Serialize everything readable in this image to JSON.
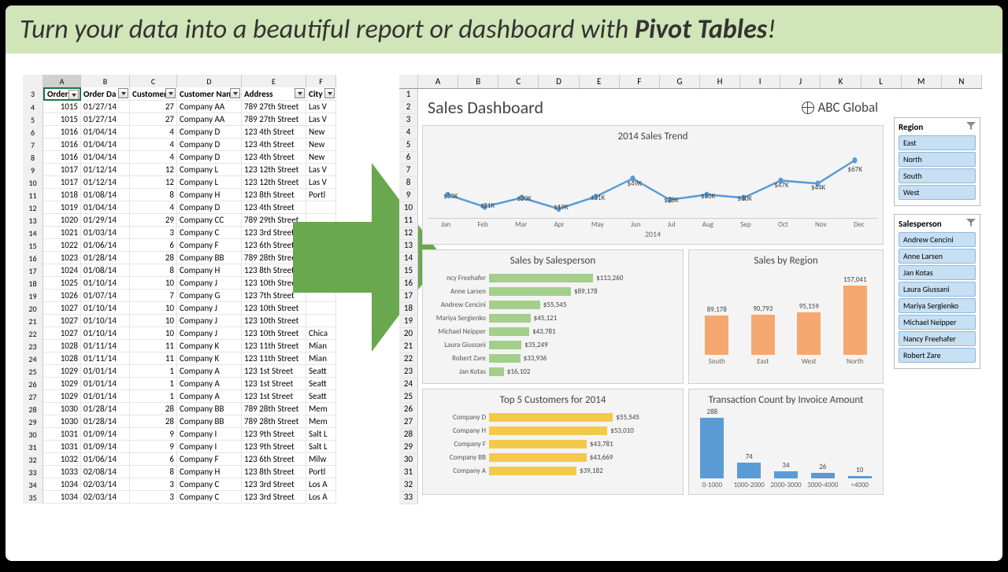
{
  "banner": {
    "text_prefix": "Turn your data into a beautiful report or dashboard with ",
    "strong": "Pivot Tables",
    "suffix": "!"
  },
  "left_cols": [
    "A",
    "B",
    "C",
    "D",
    "E",
    "F"
  ],
  "left_headers": [
    "Order",
    "Order Da",
    "Customer",
    "Customer Nan",
    "Address",
    "City"
  ],
  "left_start_row": 3,
  "rows": [
    [
      "1015",
      "01/27/14",
      "27",
      "Company AA",
      "789 27th Street",
      "Las V"
    ],
    [
      "1015",
      "01/27/14",
      "27",
      "Company AA",
      "789 27th Street",
      "Las V"
    ],
    [
      "1016",
      "01/04/14",
      "4",
      "Company D",
      "123 4th Street",
      "New"
    ],
    [
      "1016",
      "01/04/14",
      "4",
      "Company D",
      "123 4th Street",
      "New"
    ],
    [
      "1016",
      "01/04/14",
      "4",
      "Company D",
      "123 4th Street",
      "New"
    ],
    [
      "1017",
      "01/12/14",
      "12",
      "Company L",
      "123 12th Street",
      "Las V"
    ],
    [
      "1017",
      "01/12/14",
      "12",
      "Company L",
      "123 12th Street",
      "Las V"
    ],
    [
      "1018",
      "01/08/14",
      "8",
      "Company H",
      "123 8th Street",
      "Portl"
    ],
    [
      "1019",
      "01/04/14",
      "4",
      "Company D",
      "123 4th Street",
      ""
    ],
    [
      "1020",
      "01/29/14",
      "29",
      "Company CC",
      "789 29th Street",
      ""
    ],
    [
      "1021",
      "01/03/14",
      "3",
      "Company C",
      "123 3rd Street",
      ""
    ],
    [
      "1022",
      "01/06/14",
      "6",
      "Company F",
      "123 6th Street",
      ""
    ],
    [
      "1023",
      "01/28/14",
      "28",
      "Company BB",
      "789 28th Street",
      ""
    ],
    [
      "1024",
      "01/08/14",
      "8",
      "Company H",
      "123 8th Street",
      ""
    ],
    [
      "1025",
      "01/10/14",
      "10",
      "Company J",
      "123 10th Street",
      ""
    ],
    [
      "1026",
      "01/07/14",
      "7",
      "Company G",
      "123 7th Street",
      ""
    ],
    [
      "1027",
      "01/10/14",
      "10",
      "Company J",
      "123 10th Street",
      ""
    ],
    [
      "1027",
      "01/10/14",
      "10",
      "Company J",
      "123 10th Street",
      ""
    ],
    [
      "1027",
      "01/10/14",
      "10",
      "Company J",
      "123 10th Street",
      "Chica"
    ],
    [
      "1028",
      "01/11/14",
      "11",
      "Company K",
      "123 11th Street",
      "Mian"
    ],
    [
      "1028",
      "01/11/14",
      "11",
      "Company K",
      "123 11th Street",
      "Mian"
    ],
    [
      "1029",
      "01/01/14",
      "1",
      "Company A",
      "123 1st Street",
      "Seatt"
    ],
    [
      "1029",
      "01/01/14",
      "1",
      "Company A",
      "123 1st Street",
      "Seatt"
    ],
    [
      "1029",
      "01/01/14",
      "1",
      "Company A",
      "123 1st Street",
      "Seatt"
    ],
    [
      "1030",
      "01/28/14",
      "28",
      "Company BB",
      "789 28th Street",
      "Mem"
    ],
    [
      "1030",
      "01/28/14",
      "28",
      "Company BB",
      "789 28th Street",
      "Mem"
    ],
    [
      "1031",
      "01/09/14",
      "9",
      "Company I",
      "123 9th Street",
      "Salt L"
    ],
    [
      "1031",
      "01/09/14",
      "9",
      "Company I",
      "123 9th Street",
      "Salt L"
    ],
    [
      "1032",
      "01/06/14",
      "6",
      "Company F",
      "123 6th Street",
      "Milw"
    ],
    [
      "1033",
      "02/08/14",
      "8",
      "Company H",
      "123 8th Street",
      "Portl"
    ],
    [
      "1034",
      "02/03/14",
      "3",
      "Company C",
      "123 3rd Street",
      "Los A"
    ],
    [
      "1034",
      "02/03/14",
      "3",
      "Company C",
      "123 3rd Street",
      "Los A"
    ]
  ],
  "right_cols": [
    "A",
    "B",
    "C",
    "D",
    "E",
    "F",
    "G",
    "H",
    "I",
    "J",
    "K",
    "L",
    "M",
    "N"
  ],
  "dashboard": {
    "title": "Sales Dashboard",
    "company": "ABC Global"
  },
  "chart_data": [
    {
      "type": "line",
      "title": "2014 Sales Trend",
      "categories": [
        "Jan",
        "Feb",
        "Mar",
        "Apr",
        "May",
        "Jun",
        "Jul",
        "Aug",
        "Sep",
        "Oct",
        "Nov",
        "Dec"
      ],
      "values_label": [
        "$33K",
        "$21K",
        "$30K",
        "$19K",
        "$31K",
        "$49K",
        "$28K",
        "$33K",
        "$30K",
        "$47K",
        "$44K",
        "$67K"
      ],
      "values": [
        33,
        21,
        30,
        19,
        31,
        49,
        28,
        33,
        30,
        47,
        44,
        67
      ],
      "xlabel": "2014",
      "color": "#5a9bd5"
    },
    {
      "type": "bar",
      "title": "Sales by Salesperson",
      "orientation": "horizontal",
      "categories": [
        "ncy Freehafer",
        "Anne Larsen",
        "Andrew Cencini",
        "Mariya Sergienko",
        "Michael Neipper",
        "Laura Giussani",
        "Robert Zare",
        "Jan Kotas"
      ],
      "values_label": [
        "$113,260",
        "$89,178",
        "$55,545",
        "$45,121",
        "$43,781",
        "$35,249",
        "$33,936",
        "$16,102"
      ],
      "values": [
        113260,
        89178,
        55545,
        45121,
        43781,
        35249,
        33936,
        16102
      ],
      "max": 120000,
      "color": "#a3cf8b"
    },
    {
      "type": "bar",
      "title": "Sales by Region",
      "categories": [
        "South",
        "East",
        "West",
        "North"
      ],
      "values_label": [
        "89,178",
        "90,793",
        "95,159",
        "157,041"
      ],
      "values": [
        89178,
        90793,
        95159,
        157041
      ],
      "max": 160000,
      "color": "#f4a870"
    },
    {
      "type": "bar",
      "title": "Top 5 Customers for 2014",
      "orientation": "horizontal",
      "categories": [
        "Company D",
        "Company H",
        "Company F",
        "Company BB",
        "Company A"
      ],
      "values_label": [
        "$55,545",
        "$53,010",
        "$43,781",
        "$43,669",
        "$39,182"
      ],
      "values": [
        55545,
        53010,
        43781,
        43669,
        39182
      ],
      "max": 60000,
      "color": "#f3c94d"
    },
    {
      "type": "bar",
      "title": "Transaction Count by Invoice Amount",
      "categories": [
        "0-1000",
        "1000-2000",
        "2000-3000",
        "3000-4000",
        ">4000"
      ],
      "values_label": [
        "288",
        "74",
        "34",
        "26",
        "10"
      ],
      "values": [
        288,
        74,
        34,
        26,
        10
      ],
      "max": 300,
      "color": "#5a9bd5"
    }
  ],
  "slicers": {
    "region": {
      "title": "Region",
      "items": [
        "East",
        "North",
        "South",
        "West"
      ]
    },
    "salesperson": {
      "title": "Salesperson",
      "items": [
        "Andrew Cencini",
        "Anne Larsen",
        "Jan Kotas",
        "Laura Giussani",
        "Mariya Sergienko",
        "Michael Neipper",
        "Nancy Freehafer",
        "Robert Zare"
      ]
    }
  }
}
